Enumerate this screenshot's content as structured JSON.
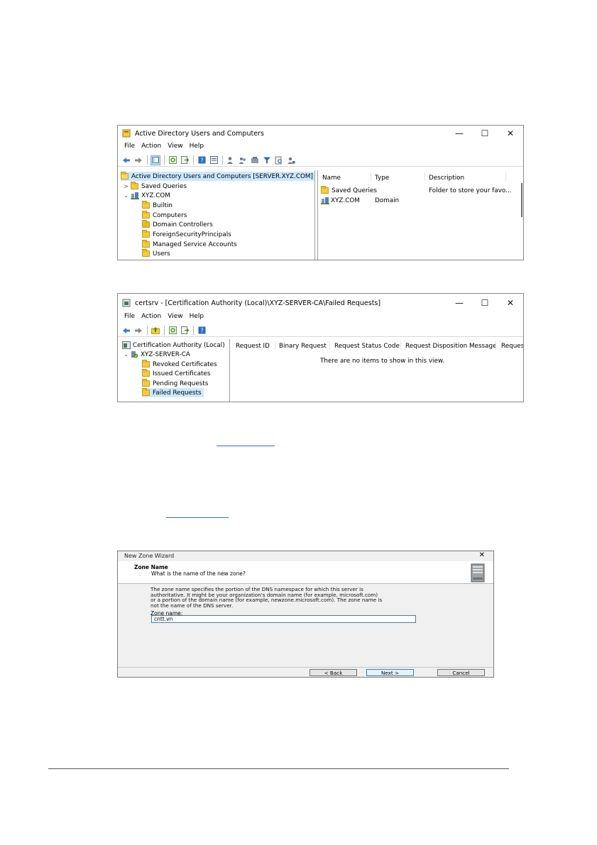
{
  "aduc": {
    "title": "Active Directory Users and Computers",
    "window_controls": {
      "minimize": "—",
      "maximize": "☐",
      "close": "✕"
    },
    "menu": [
      "File",
      "Action",
      "View",
      "Help"
    ],
    "tree": {
      "root": "Active Directory Users and Computers [SERVER.XYZ.COM]",
      "saved_queries": "Saved Queries",
      "domain": "XYZ.COM",
      "children": [
        "Builtin",
        "Computers",
        "Domain Controllers",
        "ForeignSecurityPrincipals",
        "Managed Service Accounts",
        "Users"
      ]
    },
    "columns": [
      "Name",
      "Type",
      "Description"
    ],
    "rows": [
      {
        "name": "Saved Queries",
        "type": "",
        "description": "Folder to store your favo..."
      },
      {
        "name": "XYZ.COM",
        "type": "Domain",
        "description": ""
      }
    ]
  },
  "certsrv": {
    "title": "certsrv - [Certification Authority (Local)\\XYZ-SERVER-CA\\Failed Requests]",
    "window_controls": {
      "minimize": "—",
      "maximize": "☐",
      "close": "✕"
    },
    "menu": [
      "File",
      "Action",
      "View",
      "Help"
    ],
    "tree": {
      "root": "Certification Authority (Local)",
      "ca": "XYZ-SERVER-CA",
      "children": [
        "Revoked Certificates",
        "Issued Certificates",
        "Pending Requests",
        "Failed Requests"
      ]
    },
    "columns": [
      "Request ID",
      "Binary Request",
      "Request Status Code",
      "Request Disposition Message",
      "Request"
    ],
    "empty_message": "There are no items to show in this view."
  },
  "wizard": {
    "title": "New Zone Wizard",
    "close": "✕",
    "heading": "Zone Name",
    "subheading": "What is the name of the new zone?",
    "description_lines": [
      "The zone name specifies the portion of the DNS namespace for which this server is",
      "authoritative. It might be your organization's domain name (for example, microsoft.com)",
      "or a portion of the domain name (for example, newzone.microsoft.com). The zone name is",
      "not the name of the DNS server."
    ],
    "zone_label": "Zone name:",
    "zone_value": "cntt.vn",
    "buttons": {
      "back": "< Back",
      "next": "Next >",
      "cancel": "Cancel"
    }
  },
  "colors": {
    "selection": "#cce8ff",
    "link": "#2e6fc1",
    "folder": "#f2c94c"
  }
}
